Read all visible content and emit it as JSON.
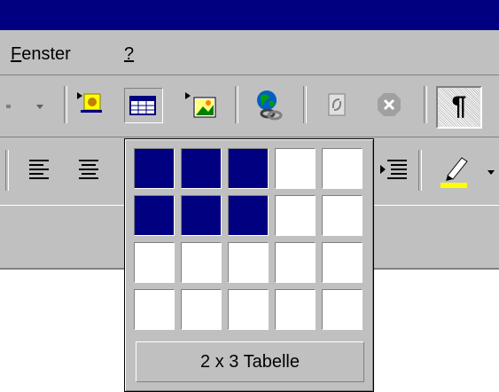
{
  "menu": {
    "items": [
      {
        "label": "Fenster",
        "accel": "F"
      },
      {
        "label": "?",
        "accel": "?"
      }
    ]
  },
  "toolbar": {
    "buttons": [
      {
        "name": "dropdown-arrow",
        "icon": "dropdown-arrow-icon"
      },
      {
        "name": "insert-text-field",
        "icon": "text-field-icon"
      },
      {
        "name": "insert-table",
        "icon": "table-icon",
        "state": "pressed"
      },
      {
        "name": "insert-picture",
        "icon": "picture-icon"
      },
      {
        "name": "web-link",
        "icon": "globe-link-icon"
      },
      {
        "name": "refresh",
        "icon": "refresh-icon"
      },
      {
        "name": "stop",
        "icon": "stop-icon"
      },
      {
        "name": "show-formatting",
        "icon": "pilcrow-icon",
        "state": "checked",
        "glyph": "¶"
      }
    ]
  },
  "format_toolbar": {
    "buttons": [
      {
        "name": "align-left",
        "icon": "align-left-icon"
      },
      {
        "name": "align-center",
        "icon": "align-center-icon"
      },
      {
        "name": "decrease-indent",
        "icon": "indent-icon"
      },
      {
        "name": "highlight",
        "icon": "highlighter-icon",
        "color": "#ffff00"
      }
    ]
  },
  "table_picker": {
    "rows_total": 4,
    "cols_total": 5,
    "selected_rows": 2,
    "selected_cols": 3,
    "label": "2 x 3 Tabelle",
    "selected_color": "#000080"
  },
  "colors": {
    "title_bar": "#000080",
    "face": "#c0c0c0"
  }
}
